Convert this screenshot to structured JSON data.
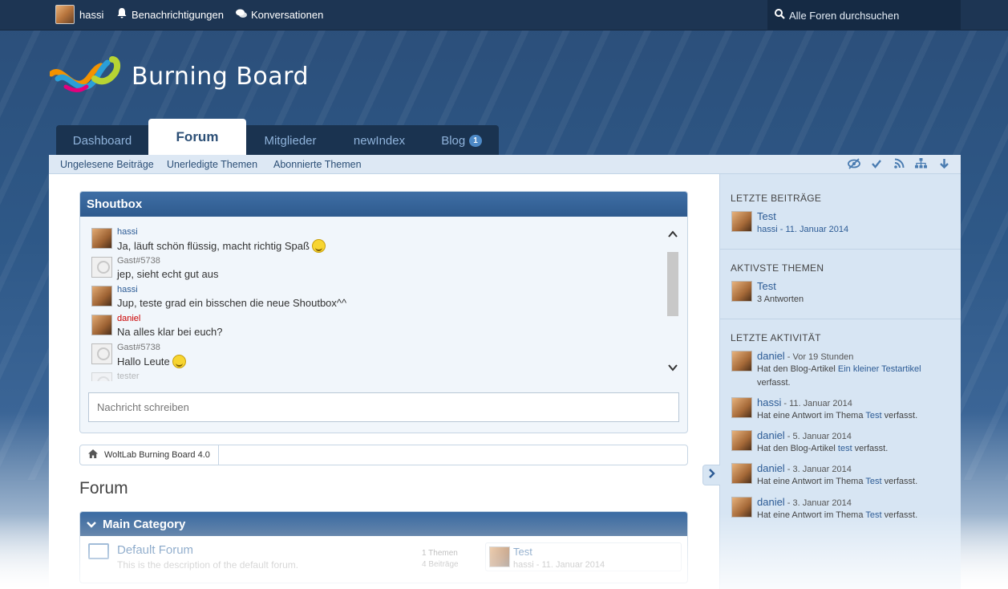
{
  "topbar": {
    "user_name": "hassi",
    "notifications_label": "Benachrichtigungen",
    "conversations_label": "Konversationen",
    "search_placeholder": "Alle Foren durchsuchen"
  },
  "logo": {
    "text": "Burning Board"
  },
  "main_nav": {
    "tabs": [
      {
        "label": "Dashboard",
        "active": false
      },
      {
        "label": "Forum",
        "active": true
      },
      {
        "label": "Mitglieder",
        "active": false
      },
      {
        "label": "newIndex",
        "active": false
      },
      {
        "label": "Blog",
        "active": false,
        "badge": "1"
      }
    ]
  },
  "sub_nav": {
    "links": [
      "Ungelesene Beiträge",
      "Unerledigte Themen",
      "Abonnierte Themen"
    ],
    "icons": [
      "mark-read-icon",
      "check-icon",
      "rss-icon",
      "sitemap-icon",
      "arrow-down-icon"
    ]
  },
  "shoutbox": {
    "title": "Shoutbox",
    "messages": [
      {
        "author": "hassi",
        "text": "Ja, läuft schön flüssig, macht richtig Spaß",
        "emoji": "grin"
      },
      {
        "author": "Gast#5738",
        "text": "jep, sieht echt gut aus"
      },
      {
        "author": "hassi",
        "text": "Jup, teste grad ein bisschen die neue Shoutbox^^"
      },
      {
        "author": "daniel",
        "text": "Na alles klar bei euch?"
      },
      {
        "author": "Gast#5738",
        "text": "Hallo Leute",
        "emoji": "smile"
      },
      {
        "author": "tester",
        "text": ""
      }
    ],
    "input_placeholder": "Nachricht schreiben"
  },
  "breadcrumb": {
    "items": [
      "WoltLab Burning Board 4.0"
    ]
  },
  "page_title": "Forum",
  "category": {
    "title": "Main Category",
    "forums": [
      {
        "name": "Default Forum",
        "description": "This is the description of the default forum.",
        "threads": "1 Themen",
        "posts": "4 Beiträge",
        "last_post_title": "Test",
        "last_post_meta": "hassi - 11. Januar 2014"
      }
    ]
  },
  "sidebar": {
    "latest_posts": {
      "heading": "LETZTE BEITRÄGE",
      "items": [
        {
          "title": "Test",
          "meta": "hassi - 11. Januar 2014"
        }
      ]
    },
    "active_threads": {
      "heading": "AKTIVSTE THEMEN",
      "items": [
        {
          "title": "Test",
          "meta": "3 Antworten"
        }
      ]
    },
    "recent_activity": {
      "heading": "LETZTE AKTIVITÄT",
      "items": [
        {
          "user": "daniel",
          "time": " - Vor 19 Stunden",
          "pre": "Hat den Blog-Artikel ",
          "link": "Ein kleiner Testartikel",
          "post": "",
          "line3": "verfasst."
        },
        {
          "user": "hassi",
          "time": " - 11. Januar 2014",
          "pre": "Hat eine Antwort im Thema ",
          "link": "Test",
          "post": " verfasst."
        },
        {
          "user": "daniel",
          "time": " - 5. Januar 2014",
          "pre": "Hat den Blog-Artikel ",
          "link": "test",
          "post": " verfasst."
        },
        {
          "user": "daniel",
          "time": " - 3. Januar 2014",
          "pre": "Hat eine Antwort im Thema ",
          "link": "Test",
          "post": " verfasst."
        },
        {
          "user": "daniel",
          "time": " - 3. Januar 2014",
          "pre": "Hat eine Antwort im Thema ",
          "link": "Test",
          "post": " verfasst."
        }
      ]
    }
  },
  "colors": {
    "header_bg": "#2e5887",
    "topbar_bg": "#1d3553",
    "link": "#2c5b95",
    "box_head": "#3e6ea5",
    "sidebar_bg": "#d7e5f3"
  }
}
